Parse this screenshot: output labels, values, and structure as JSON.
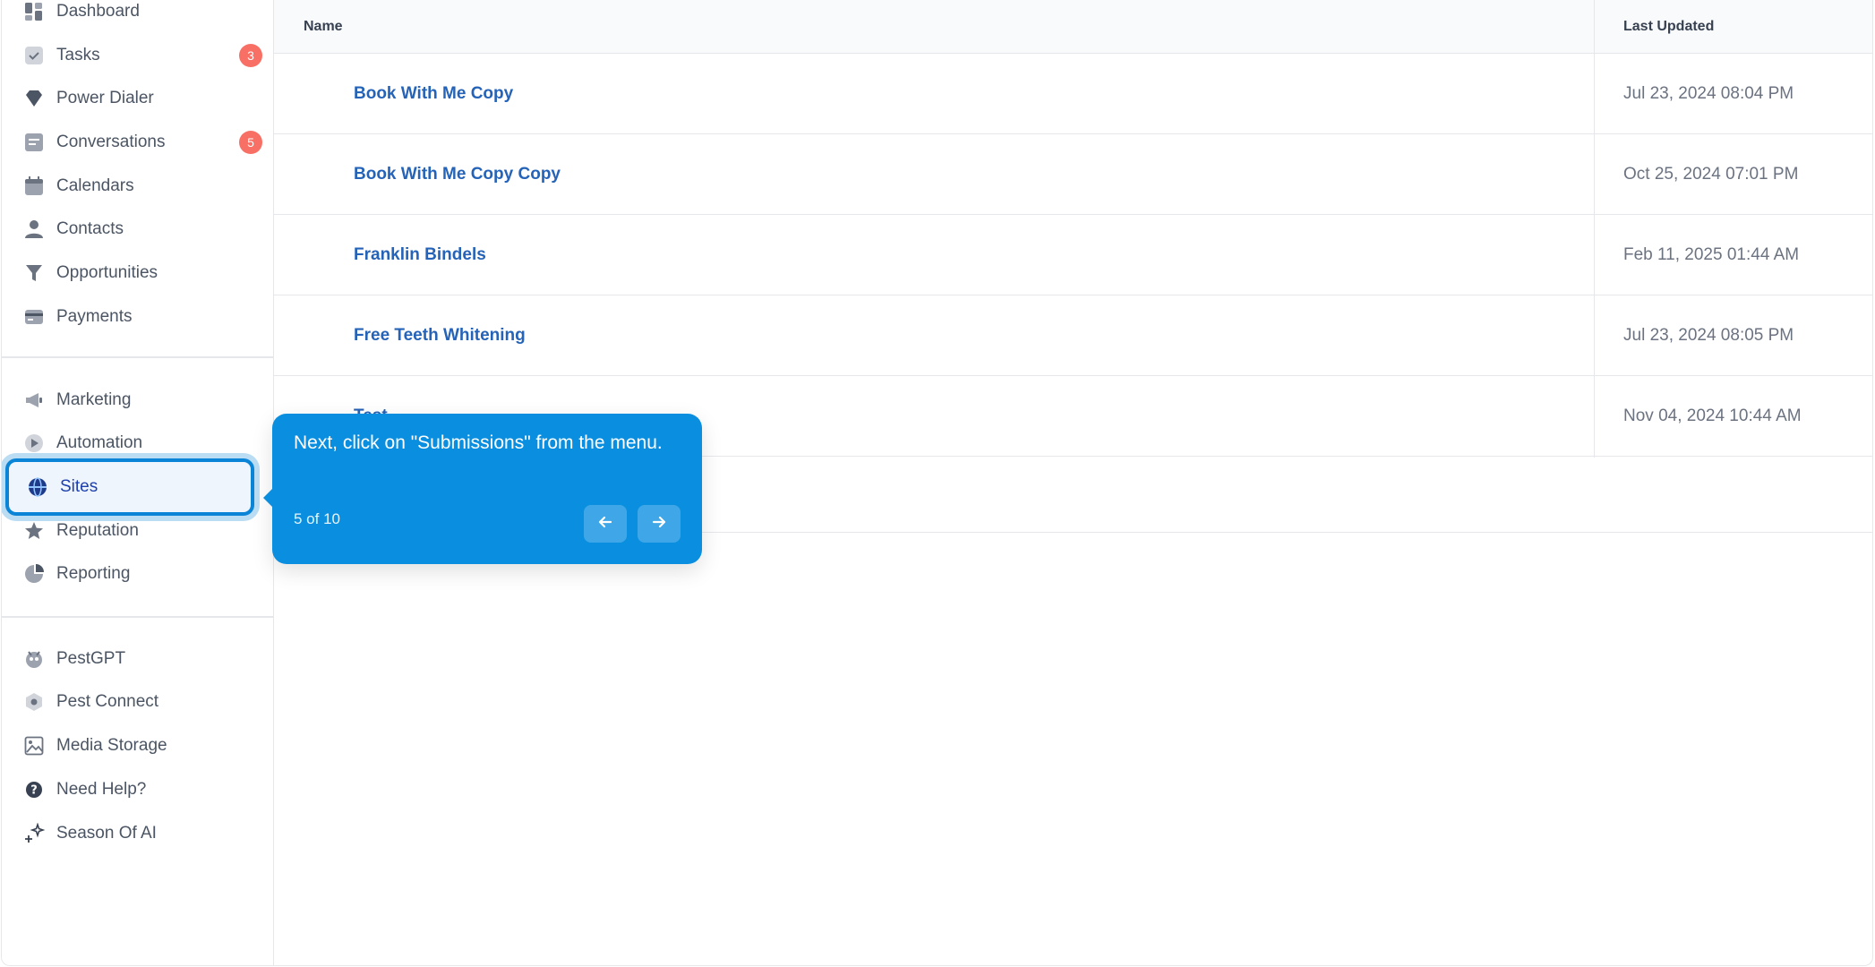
{
  "sidebar": {
    "items": [
      {
        "label": "Dashboard",
        "icon": "dashboard-icon"
      },
      {
        "label": "Tasks",
        "icon": "tasks-icon",
        "badge": "3"
      },
      {
        "label": "Power Dialer",
        "icon": "power-dialer-icon"
      },
      {
        "label": "Conversations",
        "icon": "conversations-icon",
        "badge": "5"
      },
      {
        "label": "Calendars",
        "icon": "calendar-icon"
      },
      {
        "label": "Contacts",
        "icon": "contacts-icon"
      },
      {
        "label": "Opportunities",
        "icon": "opportunities-icon"
      },
      {
        "label": "Payments",
        "icon": "payments-icon"
      },
      {
        "label": "Marketing",
        "icon": "marketing-icon"
      },
      {
        "label": "Automation",
        "icon": "automation-icon"
      },
      {
        "label": "Sites",
        "icon": "sites-icon",
        "active": true
      },
      {
        "label": "Reputation",
        "icon": "reputation-icon"
      },
      {
        "label": "Reporting",
        "icon": "reporting-icon"
      },
      {
        "label": "PestGPT",
        "icon": "pestgpt-icon"
      },
      {
        "label": "Pest Connect",
        "icon": "pest-connect-icon"
      },
      {
        "label": "Media Storage",
        "icon": "media-storage-icon"
      },
      {
        "label": "Need Help?",
        "icon": "help-icon"
      },
      {
        "label": "Season Of AI",
        "icon": "sparkles-icon"
      }
    ]
  },
  "table": {
    "headers": {
      "name": "Name",
      "last_updated": "Last Updated"
    },
    "rows": [
      {
        "name": "Book With Me Copy",
        "last_updated": "Jul 23, 2024 08:04 PM"
      },
      {
        "name": "Book With Me Copy Copy",
        "last_updated": "Oct 25, 2024 07:01 PM"
      },
      {
        "name": "Franklin Bindels",
        "last_updated": "Feb 11, 2025 01:44 AM"
      },
      {
        "name": "Free Teeth Whitening",
        "last_updated": "Jul 23, 2024 08:05 PM"
      },
      {
        "name": "Test",
        "last_updated": "Nov 04, 2024 10:44 AM"
      }
    ]
  },
  "tooltip": {
    "text": "Next, click on \"Submissions\" from the menu.",
    "step": "5 of 10",
    "prev_icon": "arrow-left-icon",
    "next_icon": "arrow-right-icon"
  },
  "colors": {
    "accent": "#0a8fe0",
    "link": "#2563b8",
    "badge": "#f87065",
    "active_border": "#0a84d6"
  }
}
